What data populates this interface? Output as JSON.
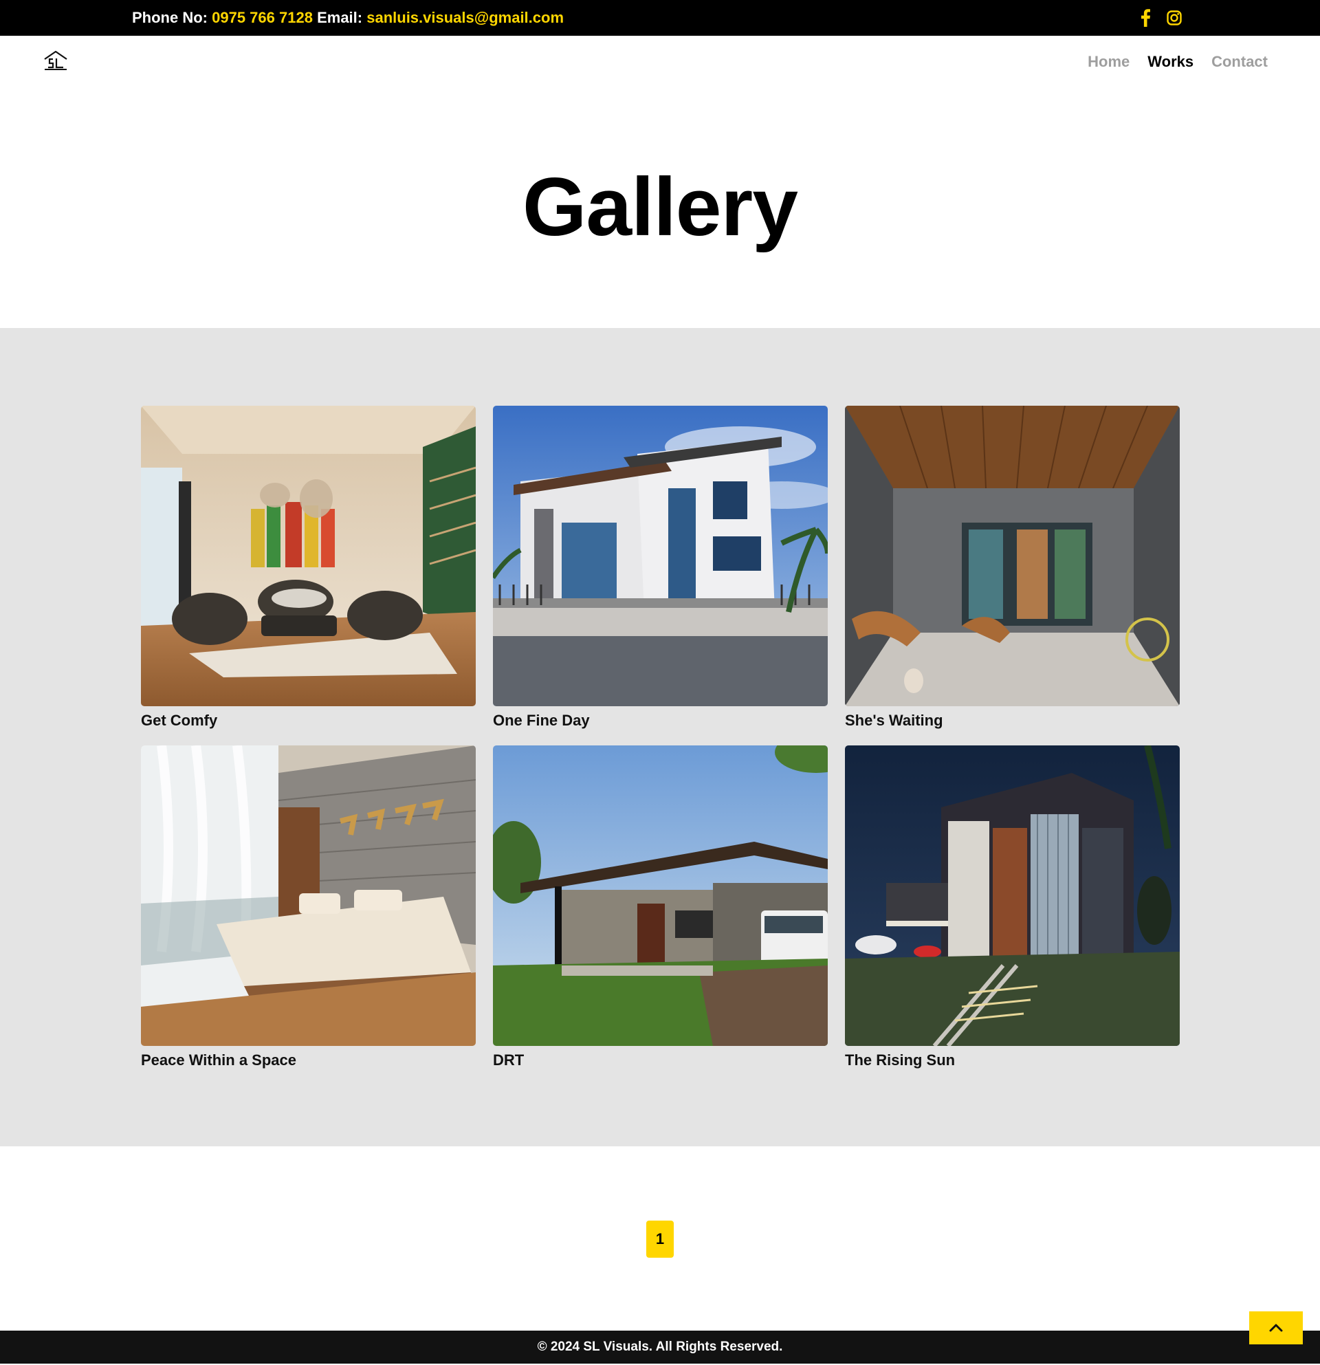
{
  "topbar": {
    "phone_label": "Phone No:",
    "phone": "0975 766 7128",
    "email_label": "Email:",
    "email": "sanluis.visuals@gmail.com",
    "socials": [
      "facebook-icon",
      "instagram-icon"
    ]
  },
  "nav": {
    "logo_icon": "house-sl-logo",
    "items": [
      {
        "label": "Home",
        "active": false
      },
      {
        "label": "Works",
        "active": true
      },
      {
        "label": "Contact",
        "active": false
      }
    ]
  },
  "hero": {
    "title": "Gallery"
  },
  "gallery": {
    "items": [
      {
        "title": "Get Comfy"
      },
      {
        "title": "One Fine Day"
      },
      {
        "title": "She's Waiting"
      },
      {
        "title": "Peace Within a Space"
      },
      {
        "title": "DRT"
      },
      {
        "title": "The Rising Sun"
      }
    ]
  },
  "pagination": {
    "current": "1"
  },
  "footer": {
    "copyright": "© 2024 SL Visuals. All Rights Reserved.",
    "back_to_top_icon": "chevron-up-icon"
  },
  "colors": {
    "accent": "#ffd600",
    "topbar_bg": "#000000",
    "band_bg": "#e4e4e4",
    "footer_bg": "#121212"
  }
}
